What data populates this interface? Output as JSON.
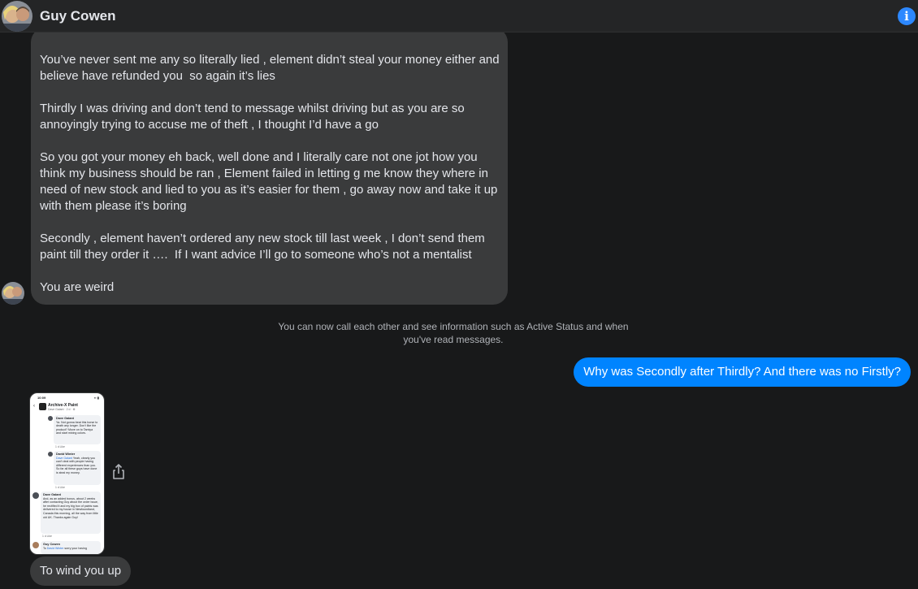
{
  "header": {
    "contact_name": "Guy Cowen",
    "info_icon": "info-icon",
    "info_glyph": "i"
  },
  "messages": {
    "long_message": {
      "paragraphs": [
        "You’ve never sent me any so literally lied , element didn’t steal your money either and believe have refunded you  so again it’s lies",
        "Thirdly I was driving and don’t tend to message whilst driving but as you are so annoyingly trying to accuse me of theft , I thought I’d have a go",
        "So you got your money eh back, well done and I literally care not one jot how you think my business should be ran , Element failed in letting g me know they where in need of new stock and lied to you as it’s easier for them , go away now and take it up with them please it’s boring",
        "Secondly , element haven’t ordered any new stock till last week , I don’t send them paint till they order it ….  If I want advice I’ll go to someone who’s not a mentalist",
        "You are weird"
      ]
    },
    "system_notice": "You can now call each other and see information such as Active Status and when you've read messages.",
    "outgoing": "Why was Secondly after Thirdly? And there was no Firstly?",
    "final_incoming": "To wind you up"
  },
  "attachment": {
    "status_time": "10:09",
    "status_icons": "▪▪ ▮",
    "group_title": "Archive-X Paint",
    "group_sub": "Dave Galant · 2 d · ⚙",
    "c1_author": "Dave Galant",
    "c1_text": "Ya. Not gonna beat this horse to death any longer. Don't like the product? Move on to Tamiya and start mixing colors.",
    "c1_meta": "1 d    Like",
    "c2_author": "David Winter",
    "c2_mention": "Dave Galant",
    "c2_text": " Yeah, clearly you can't deal with people having different experiences than you. So far all these guys have done is steal my money.",
    "c2_meta": "1 d    Like",
    "c3_author": "Dave Galant",
    "c3_text": "And, as an added bonus, about 2 weeks after contacting Guy about the order issue, he rectified it and my big box of paints was delivered to my house in Newfoundland, Canada this morning, all the way from little old  UK. Thanks again Guy!",
    "c3_meta": "1 d    Like",
    "c4_author": "Guy Cowen",
    "c4_prefix": "To ",
    "c4_mention": "David Winter",
    "c4_text": " sorry your having"
  },
  "icons": {
    "share": "share-icon"
  }
}
